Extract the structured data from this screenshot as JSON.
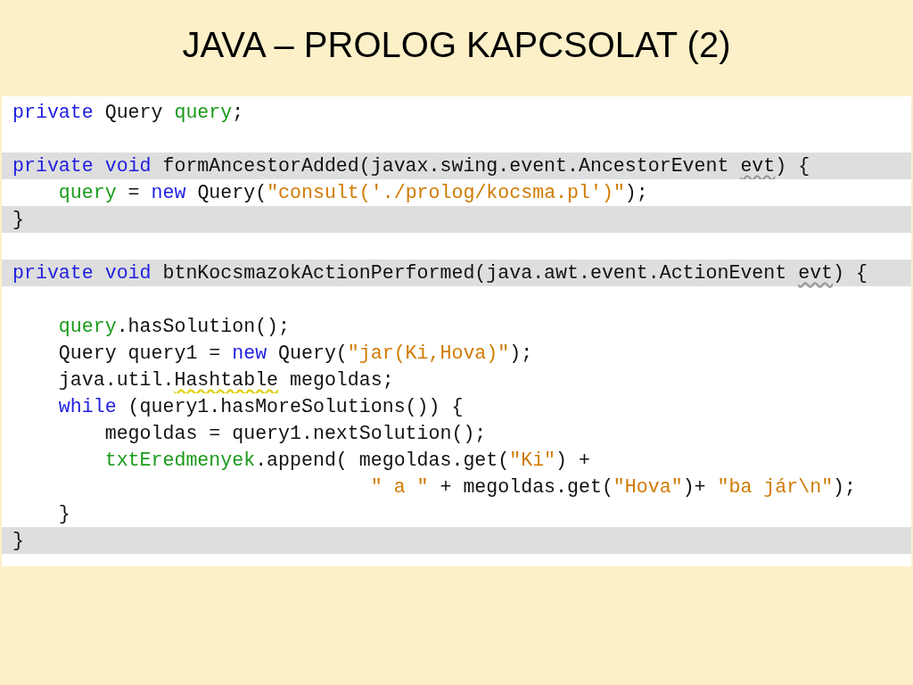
{
  "slide_title": "JAVA – PROLOG KAPCSOLAT (2)",
  "code_lines": [
    {
      "highlighted": false,
      "tokens": [
        {
          "kind": "keyword",
          "text": "private"
        },
        {
          "kind": "plain",
          "text": " Query "
        },
        {
          "kind": "field",
          "text": "query"
        },
        {
          "kind": "plain",
          "text": ";"
        }
      ]
    },
    {
      "kind": "blank"
    },
    {
      "highlighted": true,
      "tokens": [
        {
          "kind": "keyword",
          "text": "private void"
        },
        {
          "kind": "plain",
          "text": " formAncestorAdded(javax.swing.event.AncestorEvent "
        },
        {
          "kind": "unused",
          "text": "evt"
        },
        {
          "kind": "plain",
          "text": ") {"
        }
      ]
    },
    {
      "highlighted": false,
      "tokens": [
        {
          "kind": "field",
          "text": "    query"
        },
        {
          "kind": "plain",
          "text": " = "
        },
        {
          "kind": "keyword",
          "text": "new"
        },
        {
          "kind": "plain",
          "text": " Query("
        },
        {
          "kind": "string",
          "text": "\"consult('./prolog/kocsma.pl')\""
        },
        {
          "kind": "plain",
          "text": ");"
        }
      ]
    },
    {
      "highlighted": true,
      "tokens": [
        {
          "kind": "plain",
          "text": "}"
        }
      ]
    },
    {
      "kind": "blank"
    },
    {
      "highlighted": true,
      "tokens": [
        {
          "kind": "keyword",
          "text": "private void"
        },
        {
          "kind": "plain",
          "text": " btnKocsmazokActionPerformed(java.awt.event.ActionEvent "
        },
        {
          "kind": "unused",
          "text": "evt"
        },
        {
          "kind": "plain",
          "text": ") {"
        }
      ]
    },
    {
      "kind": "blank"
    },
    {
      "highlighted": false,
      "tokens": [
        {
          "kind": "field",
          "text": "    query"
        },
        {
          "kind": "plain",
          "text": ".hasSolution();"
        }
      ]
    },
    {
      "highlighted": false,
      "tokens": [
        {
          "kind": "plain",
          "text": "    Query query1 = "
        },
        {
          "kind": "keyword",
          "text": "new"
        },
        {
          "kind": "plain",
          "text": " Query("
        },
        {
          "kind": "string",
          "text": "\"jar(Ki,Hova)\""
        },
        {
          "kind": "plain",
          "text": ");"
        }
      ]
    },
    {
      "highlighted": false,
      "tokens": [
        {
          "kind": "plain",
          "text": "    java.util."
        },
        {
          "kind": "warning",
          "text": "Hashtable"
        },
        {
          "kind": "plain",
          "text": " megoldas;"
        }
      ]
    },
    {
      "highlighted": false,
      "tokens": [
        {
          "kind": "keyword",
          "text": "    while"
        },
        {
          "kind": "plain",
          "text": " (query1.hasMoreSolutions()) {"
        }
      ]
    },
    {
      "highlighted": false,
      "tokens": [
        {
          "kind": "plain",
          "text": "        megoldas = query1.nextSolution();"
        }
      ]
    },
    {
      "highlighted": false,
      "tokens": [
        {
          "kind": "field",
          "text": "        txtEredmenyek"
        },
        {
          "kind": "plain",
          "text": ".append( megoldas.get("
        },
        {
          "kind": "string",
          "text": "\"Ki\""
        },
        {
          "kind": "plain",
          "text": ") +"
        }
      ]
    },
    {
      "highlighted": false,
      "tokens": [
        {
          "kind": "string",
          "text": "                               \" a \""
        },
        {
          "kind": "plain",
          "text": " + megoldas.get("
        },
        {
          "kind": "string",
          "text": "\"Hova\""
        },
        {
          "kind": "plain",
          "text": ")+ "
        },
        {
          "kind": "string",
          "text": "\"ba jár\\n\""
        },
        {
          "kind": "plain",
          "text": ");"
        }
      ]
    },
    {
      "highlighted": false,
      "tokens": [
        {
          "kind": "plain",
          "text": "    }"
        }
      ]
    },
    {
      "highlighted": true,
      "tokens": [
        {
          "kind": "plain",
          "text": "}"
        }
      ]
    }
  ]
}
